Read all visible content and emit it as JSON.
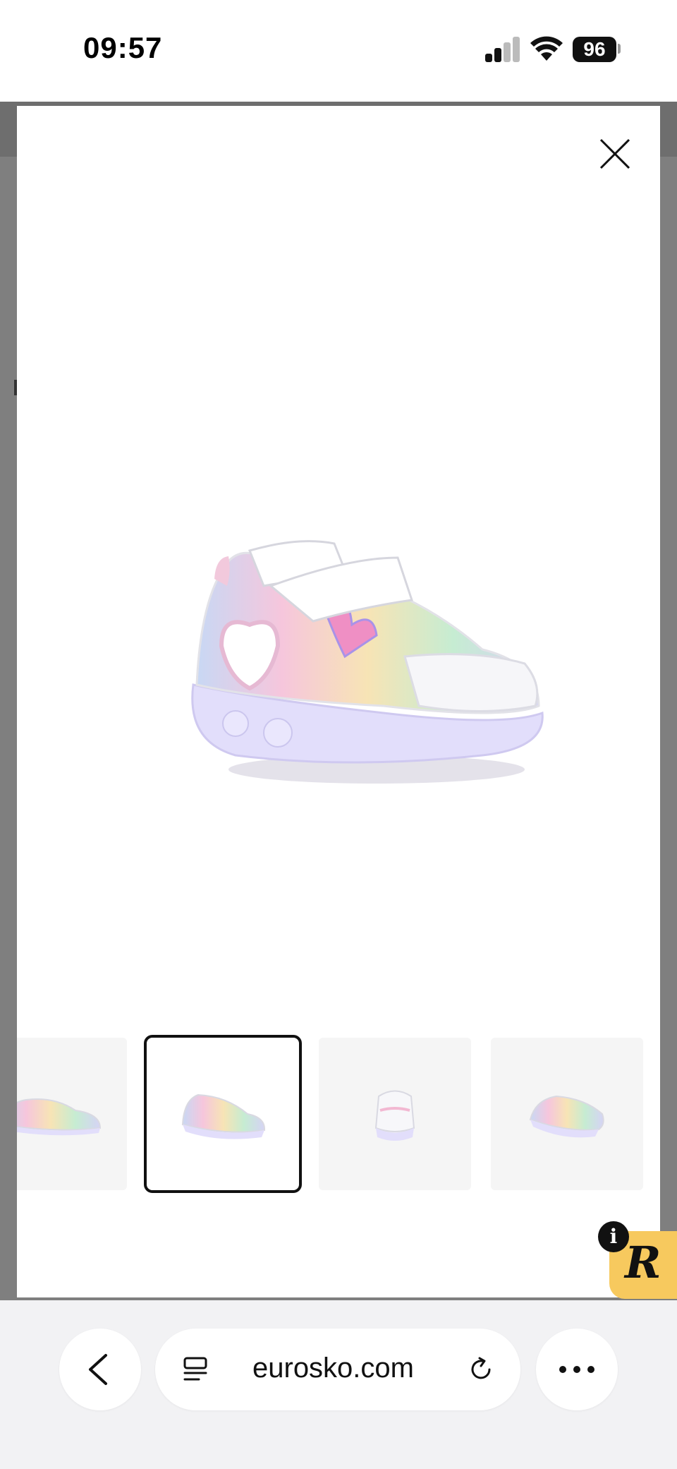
{
  "status_bar": {
    "time": "09:57",
    "battery": "96"
  },
  "modal": {
    "close_icon": "close-icon",
    "main_image": "white-pink-rainbow-kids-sneaker",
    "thumbnails": [
      {
        "name": "sneaker-side-view",
        "active": false
      },
      {
        "name": "sneaker-three-quarter-view",
        "active": true
      },
      {
        "name": "sneaker-front-view",
        "active": false
      },
      {
        "name": "sneaker-back-view",
        "active": false
      }
    ]
  },
  "badge": {
    "info": "i",
    "letter": "R",
    "color": "#f7c95e"
  },
  "browser": {
    "url": "eurosko.com",
    "back_icon": "chevron-left-icon",
    "tabs_icon": "tabs-icon",
    "reload_icon": "reload-icon",
    "more_icon": "more-icon"
  }
}
